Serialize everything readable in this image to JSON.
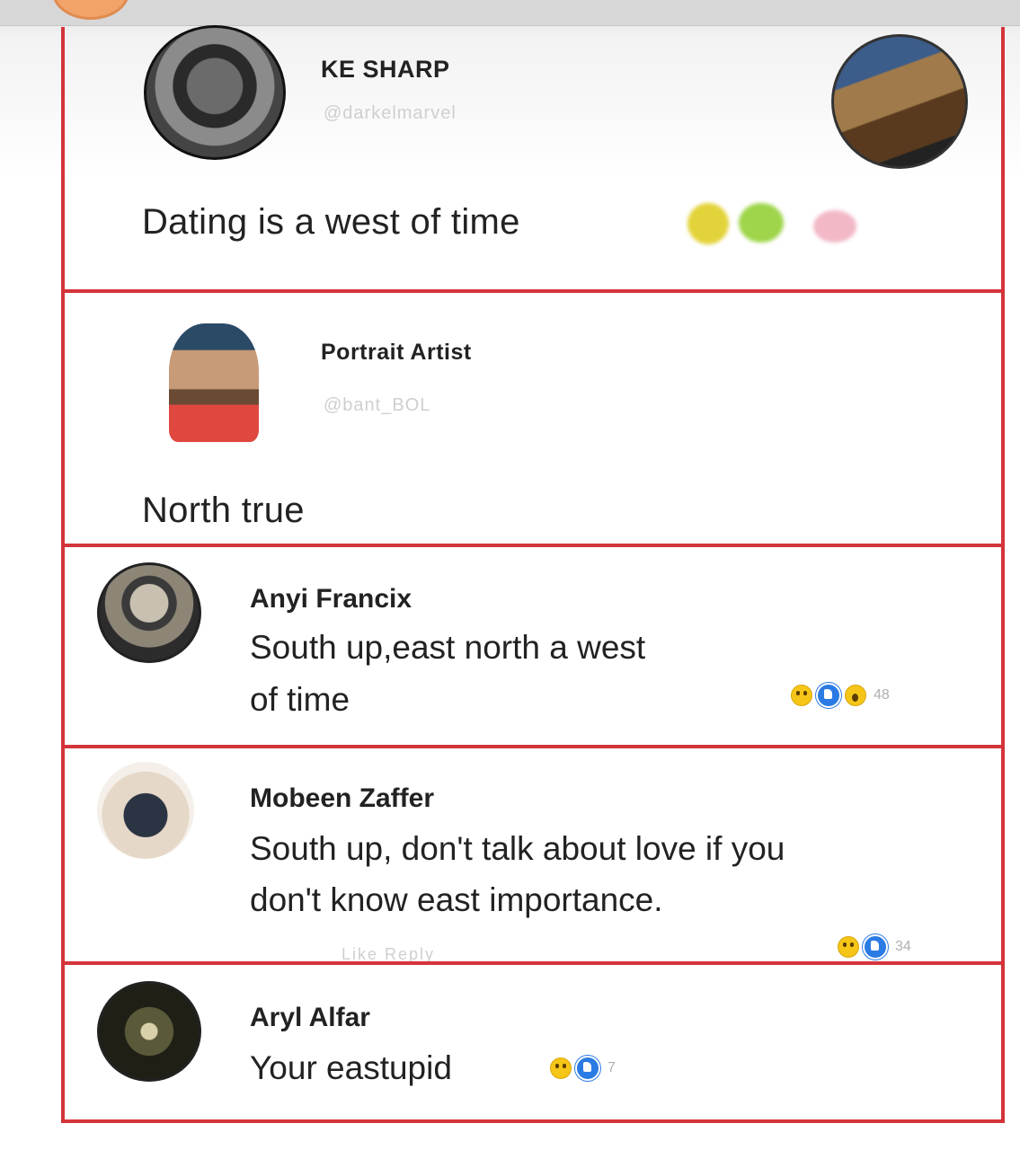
{
  "post": {
    "author_name": "KE SHARP",
    "author_handle": "@darkelmarvel",
    "text": "Dating is a west of time",
    "avatar_icon": "profile-photo-icon",
    "side_avatar_icon": "profile-photo-icon"
  },
  "reply": {
    "author_name": "Portrait Artist",
    "author_handle": "@bant_BOL",
    "text": "North true"
  },
  "comments": [
    {
      "name": "Anyi Francix",
      "text_line1": "South up,east north a west",
      "text_line2": "of time",
      "reaction_count": "48"
    },
    {
      "name": "Mobeen Zaffer",
      "text_line1": "South up, don't talk about love if you",
      "text_line2": "don't know east importance.",
      "reaction_count": "34",
      "actions": "Like   Reply"
    },
    {
      "name": "Aryl Alfar",
      "text_line1": "Your eastupid",
      "reaction_count": "7"
    }
  ],
  "colors": {
    "frame_red": "#d4343a",
    "like_blue": "#2b7be4",
    "emoji_yellow": "#f5c518"
  }
}
